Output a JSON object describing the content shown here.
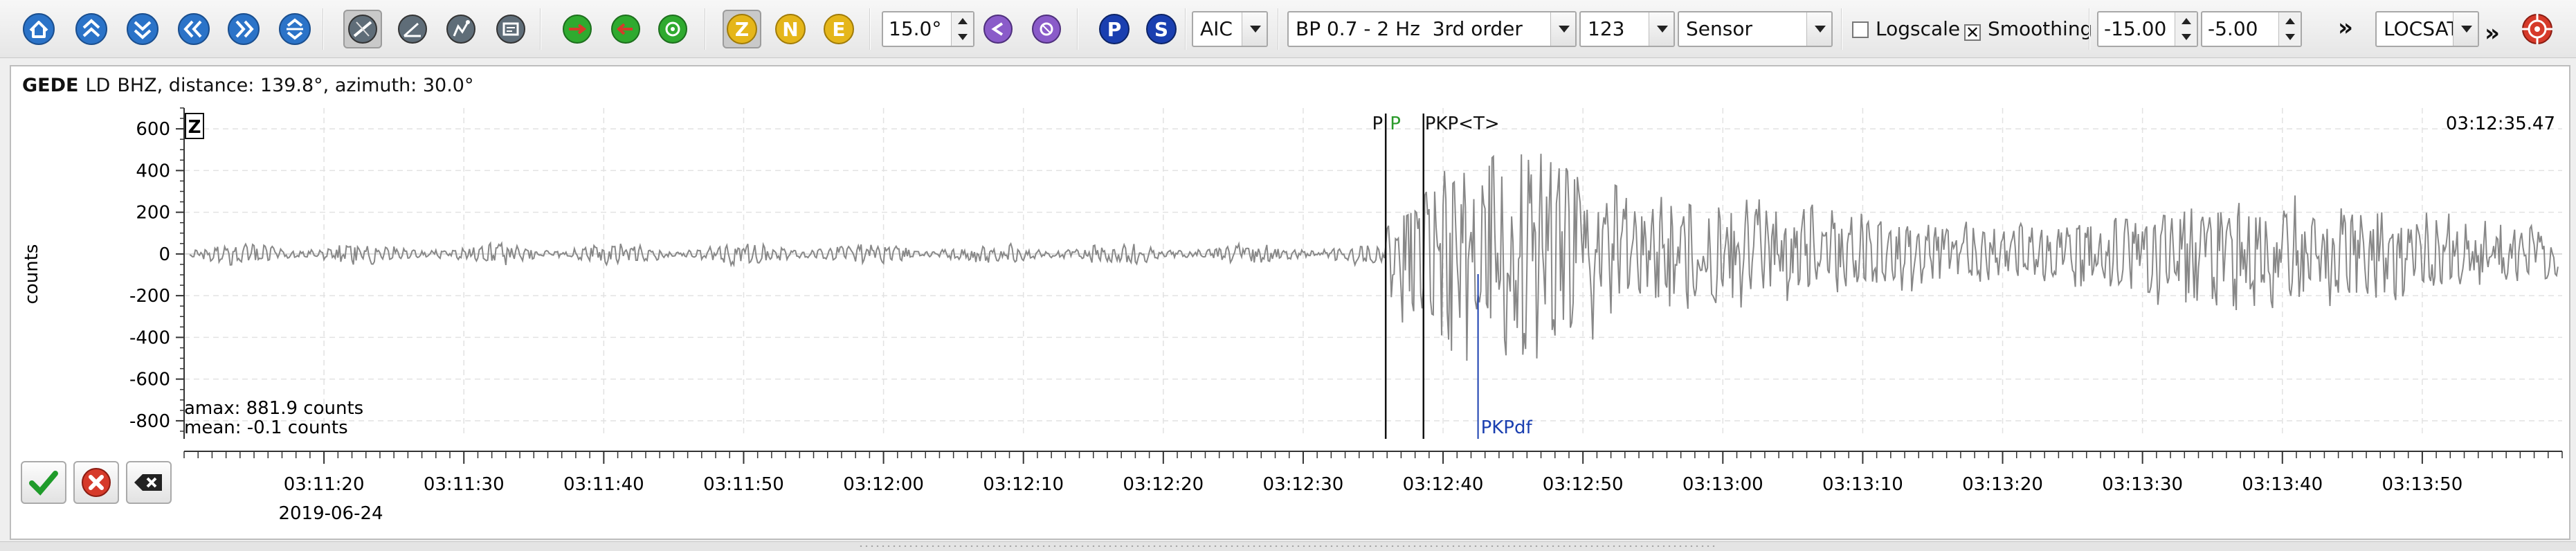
{
  "toolbar": {
    "icons": [
      {
        "name": "home-icon",
        "tip": "Home"
      },
      {
        "name": "scroll-up-icon",
        "tip": "Scroll up"
      },
      {
        "name": "scroll-down-icon",
        "tip": "Scroll down"
      },
      {
        "name": "scroll-left-icon",
        "tip": "Scroll left"
      },
      {
        "name": "scroll-right-icon",
        "tip": "Scroll right"
      },
      {
        "name": "align-icon",
        "tip": "Align"
      },
      {
        "name": "no-sort-icon",
        "tip": "Toggle"
      },
      {
        "name": "sort-by-distance-icon",
        "tip": "Sort"
      },
      {
        "name": "sort-by-azimuth-icon",
        "tip": "Sort"
      },
      {
        "name": "sort-by-residual-icon",
        "tip": "Sort"
      },
      {
        "name": "go-to-arrival-icon",
        "tip": "Arrival"
      },
      {
        "name": "previous-pick-icon",
        "tip": "Previous"
      },
      {
        "name": "next-pick-icon",
        "tip": "Next"
      }
    ],
    "components": [
      {
        "letter": "Z",
        "active": true
      },
      {
        "letter": "N",
        "active": false
      },
      {
        "letter": "E",
        "active": false
      }
    ],
    "rotation_value": "15.0°",
    "phases": [
      {
        "letter": "P"
      },
      {
        "letter": "S"
      }
    ],
    "picker_method": "AIC",
    "filter": "BP 0.7 - 2 Hz  3rd order",
    "stream_number": "123",
    "unit": "Sensor",
    "logscale_label": "Logscale",
    "logscale_checked": false,
    "smoothing_label": "Smoothing",
    "smoothing_checked": true,
    "window_start": "-15.00",
    "window_end": "-5.00",
    "more_glyph": "»",
    "locator": "LOCSAT",
    "more_glyph2": "»",
    "colors": {
      "blue": "#2b73c8",
      "green": "#2faa2f",
      "red": "#d63a2a",
      "yellow": "#e5b61a",
      "phase_blue": "#1a3fb0"
    }
  },
  "trace_info": {
    "station": "GEDE",
    "location": "LD",
    "channel": "BHZ, distance: 139.8°, azimuth: 30.0°"
  },
  "plot": {
    "component": "Z",
    "end_time": "03:12:35.47",
    "ylabel": "counts",
    "y_ticks": [
      600,
      400,
      200,
      0,
      -200,
      -400,
      -600,
      -800
    ],
    "ylim": [
      -880,
      700
    ],
    "x_ticks": [
      "03:11:20",
      "03:11:30",
      "03:11:40",
      "03:11:50",
      "03:12:00",
      "03:12:10",
      "03:12:20",
      "03:12:30",
      "03:12:40",
      "03:12:50",
      "03:13:00",
      "03:13:10",
      "03:13:20",
      "03:13:30",
      "03:13:40",
      "03:13:50"
    ],
    "x_tick_seconds": [
      80,
      90,
      100,
      110,
      120,
      130,
      140,
      150,
      160,
      170,
      180,
      190,
      200,
      210,
      220,
      230
    ],
    "xlim_seconds": [
      70.0,
      240.0
    ],
    "date": "2019-06-24",
    "amax": "amax: 881.9 counts",
    "mean": "mean: -0.1 counts",
    "picks": [
      {
        "label": "P",
        "time_s": 155.9,
        "color": "#111111",
        "label_pos": "top"
      },
      {
        "label": "P",
        "time_s": 155.9,
        "color": "#2a9a2a",
        "label_pos": "top-right"
      },
      {
        "label": "PKP<T>",
        "time_s": 158.6,
        "color": "#111111",
        "label_pos": "top"
      },
      {
        "label": "PKPdf",
        "time_s": 162.5,
        "color": "#1a3fb0",
        "label_pos": "bottom"
      }
    ]
  },
  "actions": [
    {
      "name": "accept-button",
      "tip": "Accept"
    },
    {
      "name": "cancel-button",
      "tip": "Reject"
    },
    {
      "name": "delete-button",
      "tip": "Delete"
    }
  ]
}
